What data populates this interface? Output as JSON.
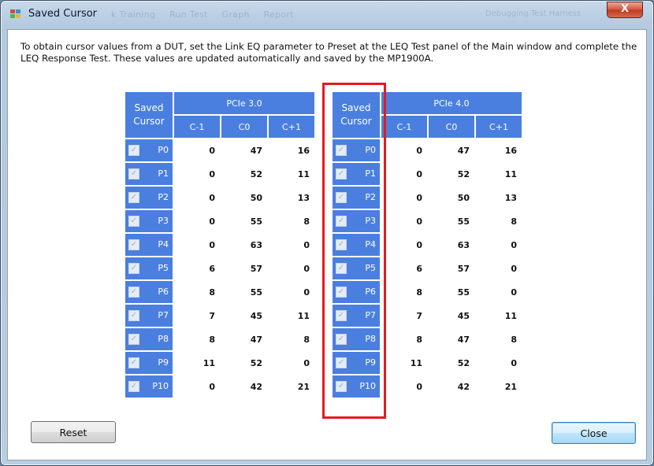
{
  "window": {
    "title": "Saved Cursor",
    "close_glyph": "X"
  },
  "background_tabs": [
    "k Training",
    "Run Test",
    "Graph",
    "Report"
  ],
  "background_right": "Debugging Test Harness",
  "description": "To obtain cursor values from a DUT, set the Link EQ parameter to Preset at the LEQ Test panel of the Main window and complete the LEQ Response Test. These values are updated automatically and saved by the MP1900A.",
  "tables": [
    {
      "saved_label_1": "Saved",
      "saved_label_2": "Cursor",
      "group_title": "PCIe 3.0",
      "columns": [
        "C-1",
        "C0",
        "C+1"
      ],
      "rows": [
        {
          "preset": "P0",
          "checked": true,
          "values": [
            "0",
            "47",
            "16"
          ]
        },
        {
          "preset": "P1",
          "checked": true,
          "values": [
            "0",
            "52",
            "11"
          ]
        },
        {
          "preset": "P2",
          "checked": true,
          "values": [
            "0",
            "50",
            "13"
          ]
        },
        {
          "preset": "P3",
          "checked": true,
          "values": [
            "0",
            "55",
            "8"
          ]
        },
        {
          "preset": "P4",
          "checked": true,
          "values": [
            "0",
            "63",
            "0"
          ]
        },
        {
          "preset": "P5",
          "checked": true,
          "values": [
            "6",
            "57",
            "0"
          ]
        },
        {
          "preset": "P6",
          "checked": true,
          "values": [
            "8",
            "55",
            "0"
          ]
        },
        {
          "preset": "P7",
          "checked": true,
          "values": [
            "7",
            "45",
            "11"
          ]
        },
        {
          "preset": "P8",
          "checked": true,
          "values": [
            "8",
            "47",
            "8"
          ]
        },
        {
          "preset": "P9",
          "checked": true,
          "values": [
            "11",
            "52",
            "0"
          ]
        },
        {
          "preset": "P10",
          "checked": true,
          "values": [
            "0",
            "42",
            "21"
          ]
        }
      ]
    },
    {
      "saved_label_1": "Saved",
      "saved_label_2": "Cursor",
      "group_title": "PCIe 4.0",
      "columns": [
        "C-1",
        "C0",
        "C+1"
      ],
      "rows": [
        {
          "preset": "P0",
          "checked": true,
          "values": [
            "0",
            "47",
            "16"
          ]
        },
        {
          "preset": "P1",
          "checked": true,
          "values": [
            "0",
            "52",
            "11"
          ]
        },
        {
          "preset": "P2",
          "checked": true,
          "values": [
            "0",
            "50",
            "13"
          ]
        },
        {
          "preset": "P3",
          "checked": true,
          "values": [
            "0",
            "55",
            "8"
          ]
        },
        {
          "preset": "P4",
          "checked": true,
          "values": [
            "0",
            "63",
            "0"
          ]
        },
        {
          "preset": "P5",
          "checked": true,
          "values": [
            "6",
            "57",
            "0"
          ]
        },
        {
          "preset": "P6",
          "checked": true,
          "values": [
            "8",
            "55",
            "0"
          ]
        },
        {
          "preset": "P7",
          "checked": true,
          "values": [
            "7",
            "45",
            "11"
          ]
        },
        {
          "preset": "P8",
          "checked": true,
          "values": [
            "8",
            "47",
            "8"
          ]
        },
        {
          "preset": "P9",
          "checked": true,
          "values": [
            "11",
            "52",
            "0"
          ]
        },
        {
          "preset": "P10",
          "checked": true,
          "values": [
            "0",
            "42",
            "21"
          ]
        }
      ]
    }
  ],
  "buttons": {
    "reset": "Reset",
    "close": "Close"
  },
  "colors": {
    "header_blue": "#4a7fe0",
    "highlight_red": "#e41b1b",
    "close_red": "#c0391f"
  },
  "icons": {
    "check": "✓"
  }
}
